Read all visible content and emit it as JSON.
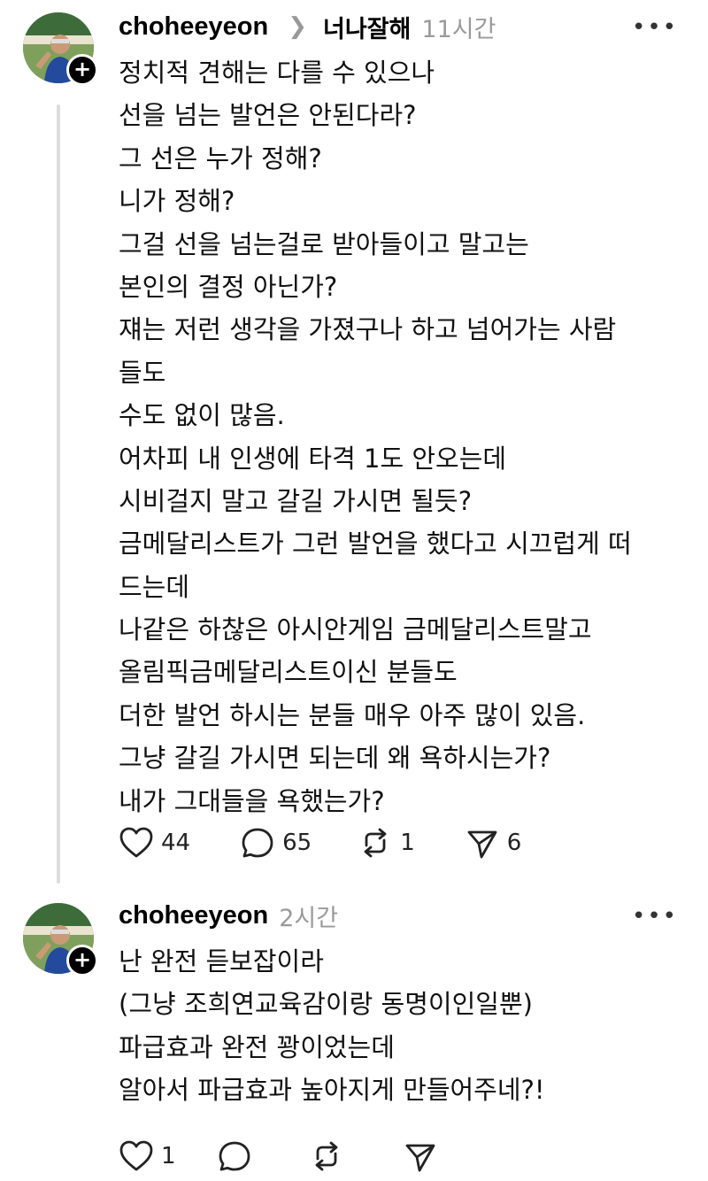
{
  "post1": {
    "username": "choheeyeon",
    "reply_target": "너나잘해",
    "time": "11시간",
    "lines": [
      "정치적 견해는 다를 수 있으나",
      "선을 넘는 발언은 안된다라?",
      "그 선은 누가 정해?",
      "니가 정해?",
      "그걸 선을 넘는걸로 받아들이고 말고는",
      "본인의 결정 아닌가?",
      "쟤는 저런 생각을 가졌구나 하고 넘어가는 사람",
      "들도",
      "수도 없이 많음.",
      "어차피 내 인생에 타격 1도 안오는데",
      "시비걸지 말고 갈길 가시면 될듯?",
      "금메달리스트가 그런 발언을 했다고 시끄럽게 떠",
      "드는데",
      "나같은 하찮은 아시안게임 금메달리스트말고",
      "올림픽금메달리스트이신 분들도",
      "더한 발언 하시는 분들 매우 아주 많이 있음.",
      "그냥 갈길 가시면 되는데 왜 욕하시는가?",
      "내가 그대들을 욕했는가?"
    ],
    "likes": "44",
    "replies": "65",
    "reposts": "1",
    "shares": "6"
  },
  "post2": {
    "username": "choheeyeon",
    "time": "2시간",
    "lines": [
      "난 완전 듣보잡이라",
      "(그냥 조희연교육감이랑 동명이인일뿐)",
      "파급효과 완전 꽝이었는데",
      "알아서 파급효과 높아지게 만들어주네?!"
    ],
    "likes": "1"
  },
  "icons": [
    "heart-icon",
    "comment-icon",
    "repost-icon",
    "share-icon",
    "more-icon",
    "follow-plus-icon"
  ],
  "more_label": "•••",
  "plus_label": "+"
}
